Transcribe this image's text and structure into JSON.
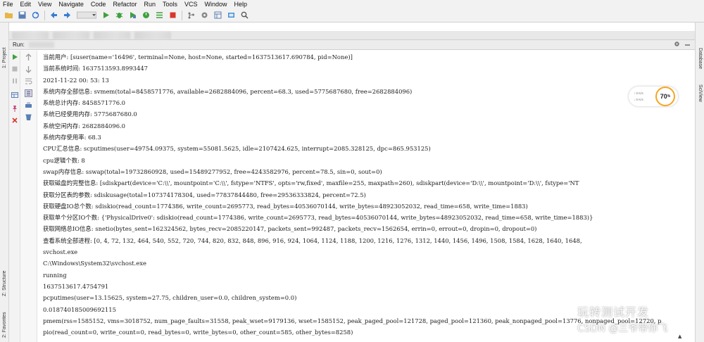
{
  "menu": [
    "File",
    "Edit",
    "View",
    "Navigate",
    "Code",
    "Refactor",
    "Run",
    "Tools",
    "VCS",
    "Window",
    "Help"
  ],
  "toolbar": {
    "icons": [
      "folder-open-icon",
      "save-icon",
      "sync-icon",
      "back-icon",
      "forward-icon",
      "run-config-icon",
      "run-icon",
      "debug-icon",
      "coverage-icon",
      "profile-icon",
      "concurrency-icon",
      "stop-icon",
      "vcs-icon",
      "settings-icon",
      "structure-icon",
      "sdk-icon",
      "search-icon"
    ]
  },
  "left_strip": {
    "project_tab": "1: Project",
    "structure_tab": "Z: Structure",
    "favorites_tab": "2: Favorites"
  },
  "right_strip": {
    "database_tab": "Database",
    "sciview_tab": "SciView"
  },
  "run": {
    "label": "Run:"
  },
  "console_lines": [
    "当前用户: [suser(name='16496', terminal=None, host=None, started=1637513617.690784, pid=None)]",
    "当前系统时间: 1637513593.8993447",
    "2021-11-22 00: 53: 13",
    "系统内存全部信息: svmem(total=8458571776, available=2682884096, percent=68.3, used=5775687680, free=2682884096)",
    "系统总计内存: 8458571776.0",
    "系统已经使用内存: 5775687680.0",
    "系统空闲内存: 2682884096.0",
    "系统内存使用率: 68.3",
    "CPU汇总信息: scputimes(user=49754.09375, system=55081.5625, idle=2107424.625, interrupt=2085.328125, dpc=865.953125)",
    "cpu逻辑个数: 8",
    "swap内存信息: sswap(total=19732860928, used=15489277952, free=4243582976, percent=78.5, sin=0, sout=0)",
    "获取磁盘的完整信息: [sdiskpart(device='C:\\\\', mountpoint='C:\\\\', fstype='NTFS', opts='rw,fixed', maxfile=255, maxpath=260), sdiskpart(device='D:\\\\', mountpoint='D:\\\\', fstype='NT",
    "获取分区表的参数: sdiskusage(total=107374178304, used=77837844480, free=29536333824, percent=72.5)",
    "获取硬盘IO总个数: sdiskio(read_count=1774386, write_count=2695773, read_bytes=40536070144, write_bytes=48923052032, read_time=658, write_time=1883)",
    "获取单个分区IO个数: {'PhysicalDrive0': sdiskio(read_count=1774386, write_count=2695773, read_bytes=40536070144, write_bytes=48923052032, read_time=658, write_time=1883)}",
    "获取网络总IO信息: snetio(bytes_sent=162324562, bytes_recv=2085220147, packets_sent=992487, packets_recv=1562654, errin=0, errout=0, dropin=0, dropout=0)",
    "查看系统全部进程: [0, 4, 72, 132, 464, 540, 552, 720, 744, 820, 832, 848, 896, 916, 924, 1064, 1124, 1188, 1200, 1216, 1276, 1312, 1440, 1456, 1496, 1508, 1584, 1628, 1640, 1648,",
    "svchost.exe",
    "C:\\Windows\\System32\\svchost.exe",
    "running",
    "1637513617.4754791",
    "pcputimes(user=13.15625, system=27.75, children_user=0.0, children_system=0.0)",
    "0.018740185009692115",
    "pmem(rss=1585152, vms=3018752, num_page_faults=31558, peak_wset=9179136, wset=1585152, peak_paged_pool=121728, paged_pool=121360, peak_nonpaged_pool=13776, nonpaged_pool=12720, p",
    "pio(read_count=0, write_count=0, read_bytes=0, write_bytes=0, other_count=585, other_bytes=8258)"
  ],
  "memory_widget": {
    "up_rate": "0 K/s",
    "down_rate": "0 K/s",
    "percent": "70",
    "unit": "%"
  },
  "watermark": {
    "wechat_text": "玩转测试开发",
    "csdn_text": "CSDN @三爷带你飞"
  },
  "colors": {
    "run_green": "#3fa03f",
    "debug_green": "#3fa03f",
    "stop_red": "#d9362b",
    "accent_orange": "#f5a623"
  }
}
